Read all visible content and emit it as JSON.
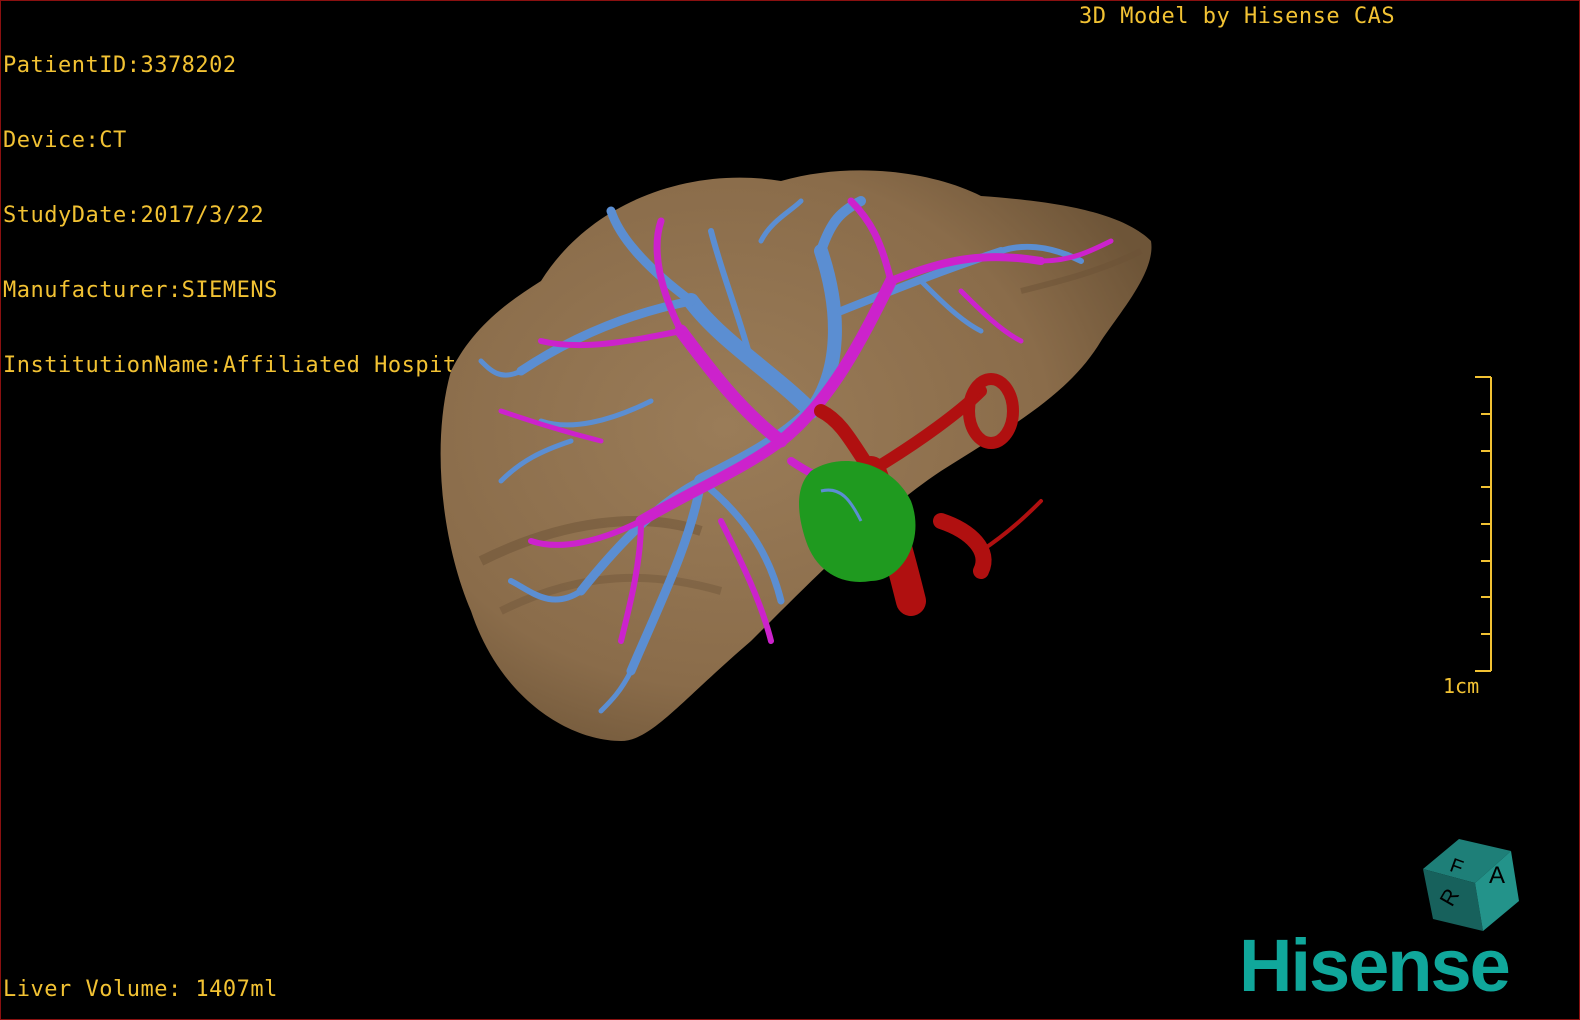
{
  "study_info": {
    "patient_id": "PatientID:3378202",
    "device": "Device:CT",
    "study_date": "StudyDate:2017/3/22",
    "manufacturer": "Manufacturer:SIEMENS",
    "institution": "InstitutionName:Affiliated Hospital Qingdao University-C"
  },
  "viewer_title": "3D Model by Hisense CAS",
  "liver_volume": "Liver Volume: 1407ml",
  "scale_bar": {
    "label": "1cm",
    "tick_count": 9
  },
  "orientation_cube": {
    "labels": [
      "A",
      "R",
      "F"
    ]
  },
  "brand_logo": "Hisense",
  "colors": {
    "overlay_text": "#f2c233",
    "liver": "#8c7050",
    "portal_vein": "#5b8ed2",
    "hepatic_vein": "#cc22cc",
    "artery": "#b01010",
    "tumor": "#1f9a1f",
    "brand": "#10a79b",
    "viewport_border": "#8a1010"
  },
  "icons": {
    "orientation_cube": "orientation-cube-icon",
    "scale_bar": "scale-bar-icon"
  }
}
